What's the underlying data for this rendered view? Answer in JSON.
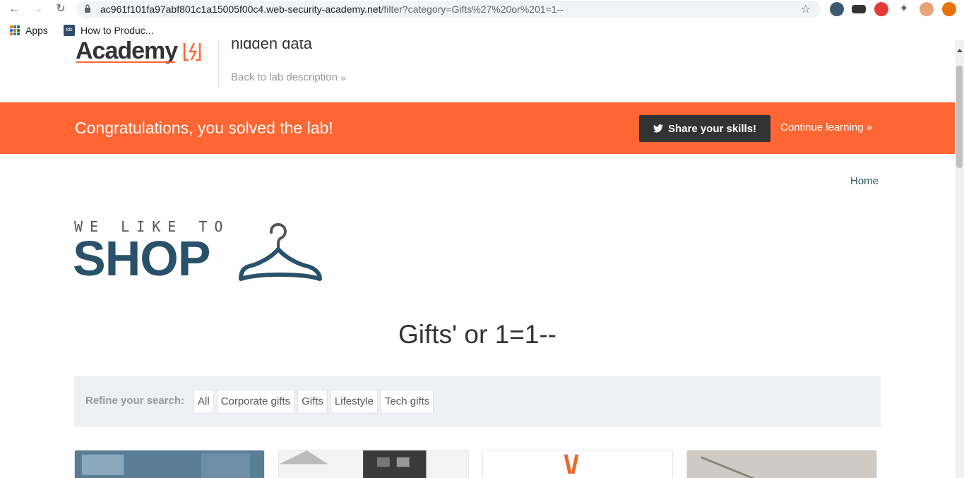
{
  "browser": {
    "url_host": "ac961f101fa97abf801c1a15005f00c4.web-security-academy.net",
    "url_path": "/filter?category=Gifts%27%20or%201=1--",
    "bookmarks": [
      {
        "label": "Apps",
        "icon": "apps-grid-icon"
      },
      {
        "label": "How to Produc...",
        "icon": "tds-favicon"
      }
    ]
  },
  "academy": {
    "logo": "Academy",
    "lab_title": "hidden data",
    "back_link": "Back to lab description"
  },
  "banner": {
    "message": "Congratulations, you solved the lab!",
    "share_label": "Share your skills!",
    "continue_label": "Continue learning",
    "color": "#ff6633"
  },
  "shop": {
    "nav_home": "Home",
    "logo_tagline": "WE LIKE TO",
    "logo_word": "SHOP",
    "category_heading": "Gifts' or 1=1--",
    "refine_label": "Refine your search:",
    "filters": [
      "All",
      "Corporate gifts",
      "Gifts",
      "Lifestyle",
      "Tech gifts"
    ],
    "accent": "#29526a"
  }
}
